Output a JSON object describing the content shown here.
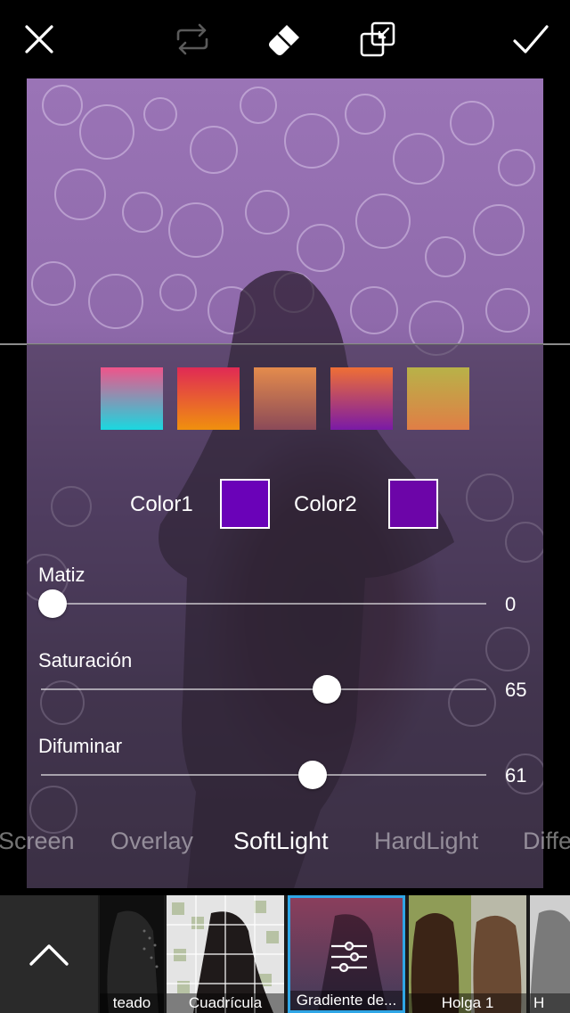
{
  "toolbar": {
    "close_icon": "close-icon",
    "swap_icon": "swap-icon",
    "eraser_icon": "eraser-icon",
    "resize_icon": "resize-icon",
    "apply_icon": "check-icon"
  },
  "gradient_presets": [
    {
      "from": "#f0548a",
      "to": "#19d8e0"
    },
    {
      "from": "#e02a55",
      "to": "#f0900e"
    },
    {
      "from": "#e48b4c",
      "to": "#8b4a58"
    },
    {
      "from": "#ef6f35",
      "to": "#7a1aa6"
    },
    {
      "from": "#b8b248",
      "to": "#e07e46"
    }
  ],
  "colors": {
    "color1_label": "Color1",
    "color1_value": "#6a02b8",
    "color2_label": "Color2",
    "color2_value": "#6c05a8"
  },
  "sliders": [
    {
      "label": "Matiz",
      "value": "0",
      "fraction": 0.026
    },
    {
      "label": "Saturación",
      "value": "65",
      "fraction": 0.642
    },
    {
      "label": "Difuminar",
      "value": "61",
      "fraction": 0.61
    }
  ],
  "blend_modes": {
    "items": [
      "Screen",
      "Overlay",
      "SoftLight",
      "HardLight",
      "Diffe"
    ],
    "selected": "SoftLight"
  },
  "effects": {
    "items": [
      "teado",
      "Cuadrícula",
      "Gradiente de...",
      "Holga 1",
      "H"
    ],
    "selected": "Gradiente de..."
  },
  "accent": "#2fa6e6"
}
